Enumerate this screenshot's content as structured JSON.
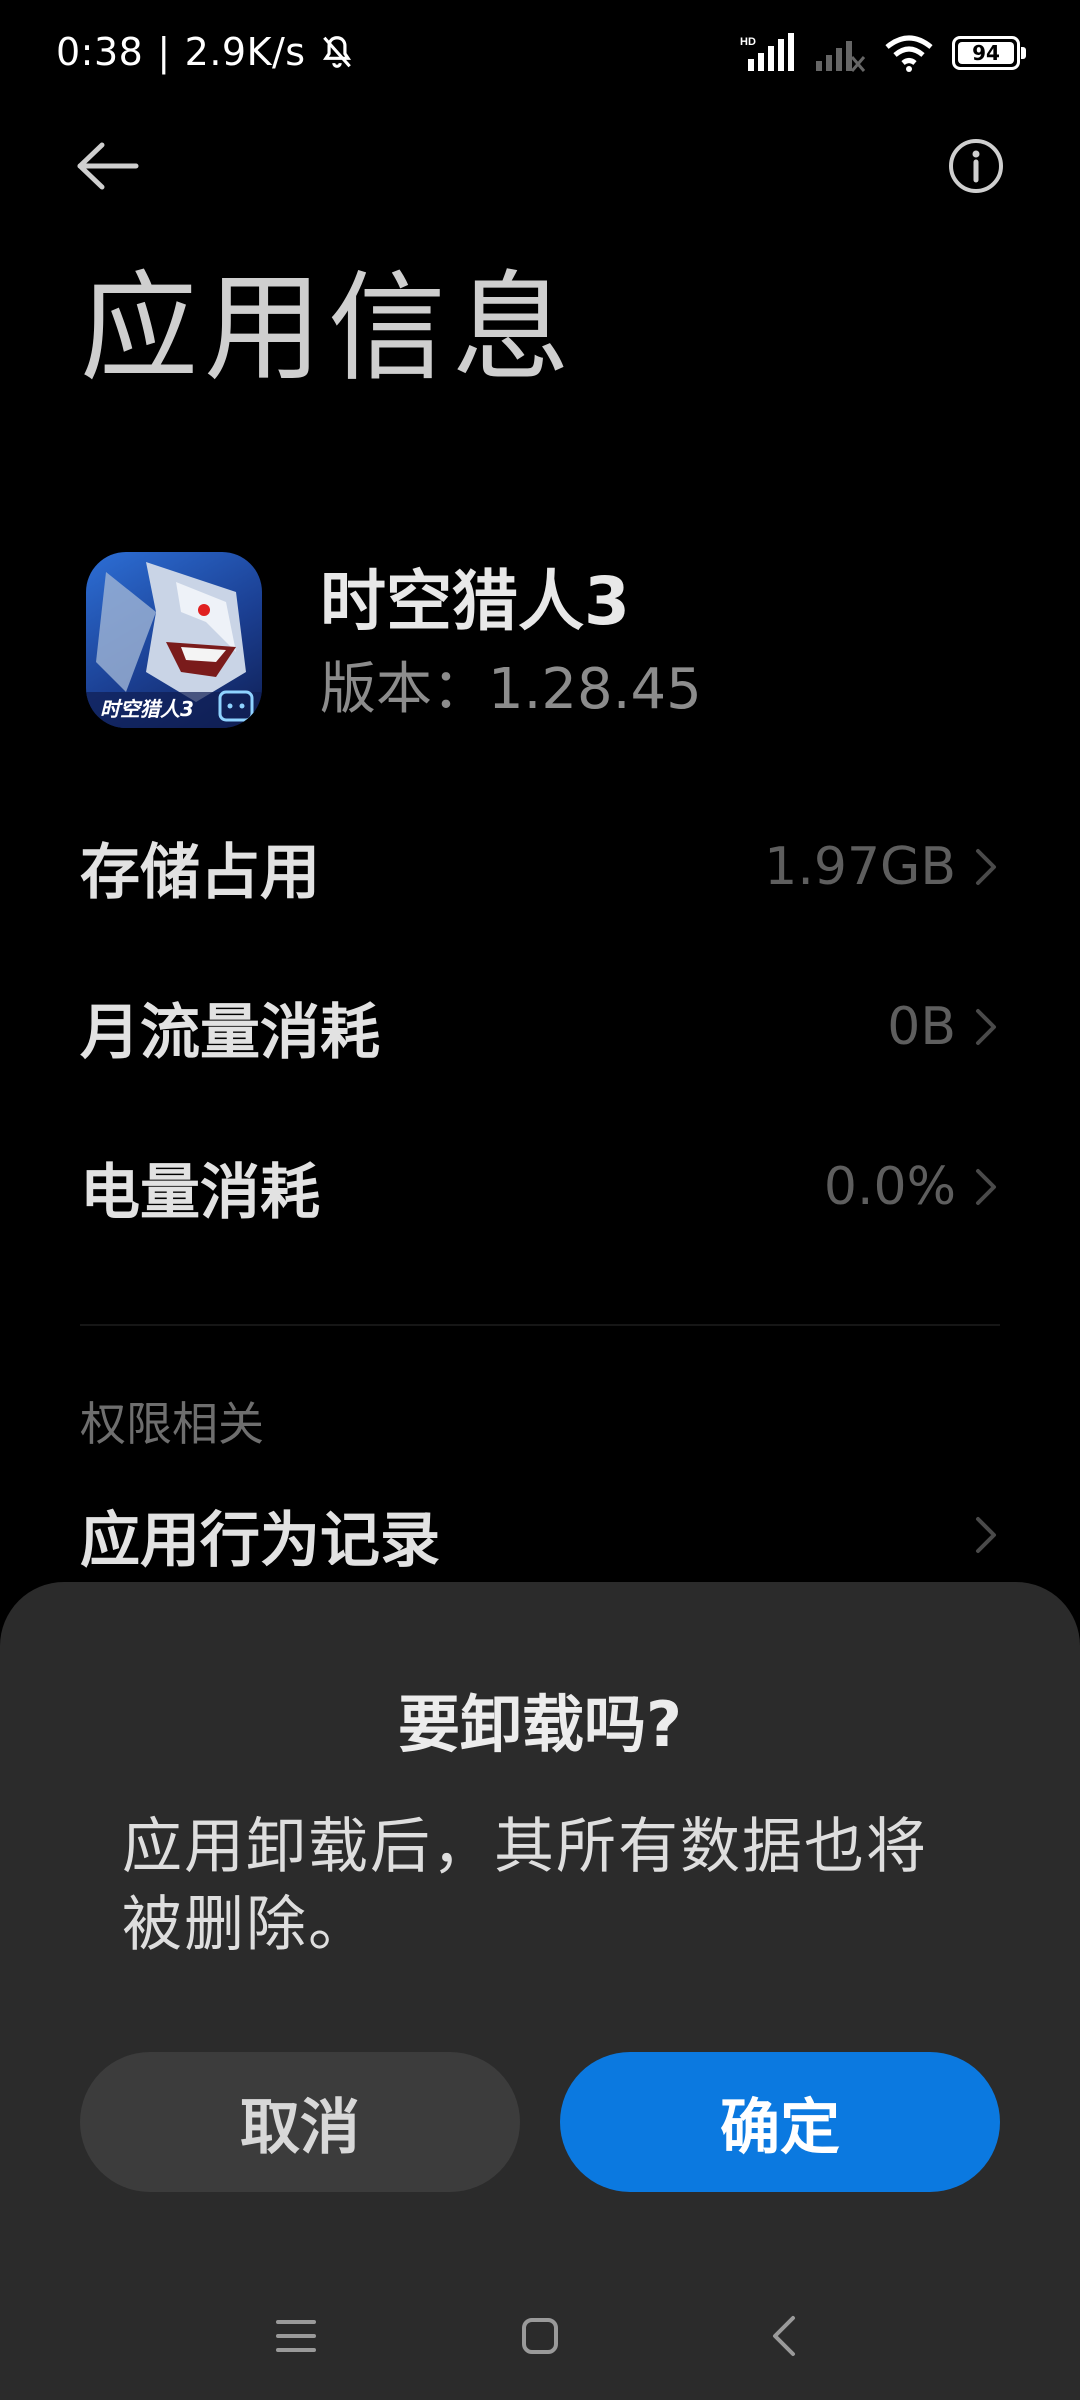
{
  "status_bar": {
    "time": "0:38",
    "separator": "|",
    "net_speed": "2.9K/s",
    "hd_label": "HD",
    "battery": "94"
  },
  "page": {
    "title": "应用信息"
  },
  "app": {
    "name": "时空猎人3",
    "version_label": "版本：",
    "version": "1.28.45",
    "icon_text": "时空猎人3"
  },
  "rows": [
    {
      "label": "存储占用",
      "value": "1.97GB"
    },
    {
      "label": "月流量消耗",
      "value": "0B"
    },
    {
      "label": "电量消耗",
      "value": "0.0%"
    }
  ],
  "permissions": {
    "header": "权限相关",
    "behavior_record_label": "应用行为记录"
  },
  "dialog": {
    "title": "要卸载吗?",
    "message": "应用卸载后，其所有数据也将被删除。",
    "cancel_label": "取消",
    "confirm_label": "确定"
  },
  "colors": {
    "accent": "#0b79e0",
    "background": "#000000",
    "dialog_bg": "#2b2b2b"
  },
  "icons": {
    "back": "back-arrow-icon",
    "info": "info-icon",
    "chevron": "chevron-right-icon",
    "bell_off": "bell-off-icon",
    "nav_menu": "menu-icon",
    "nav_home": "home-icon",
    "nav_back": "nav-back-icon"
  }
}
